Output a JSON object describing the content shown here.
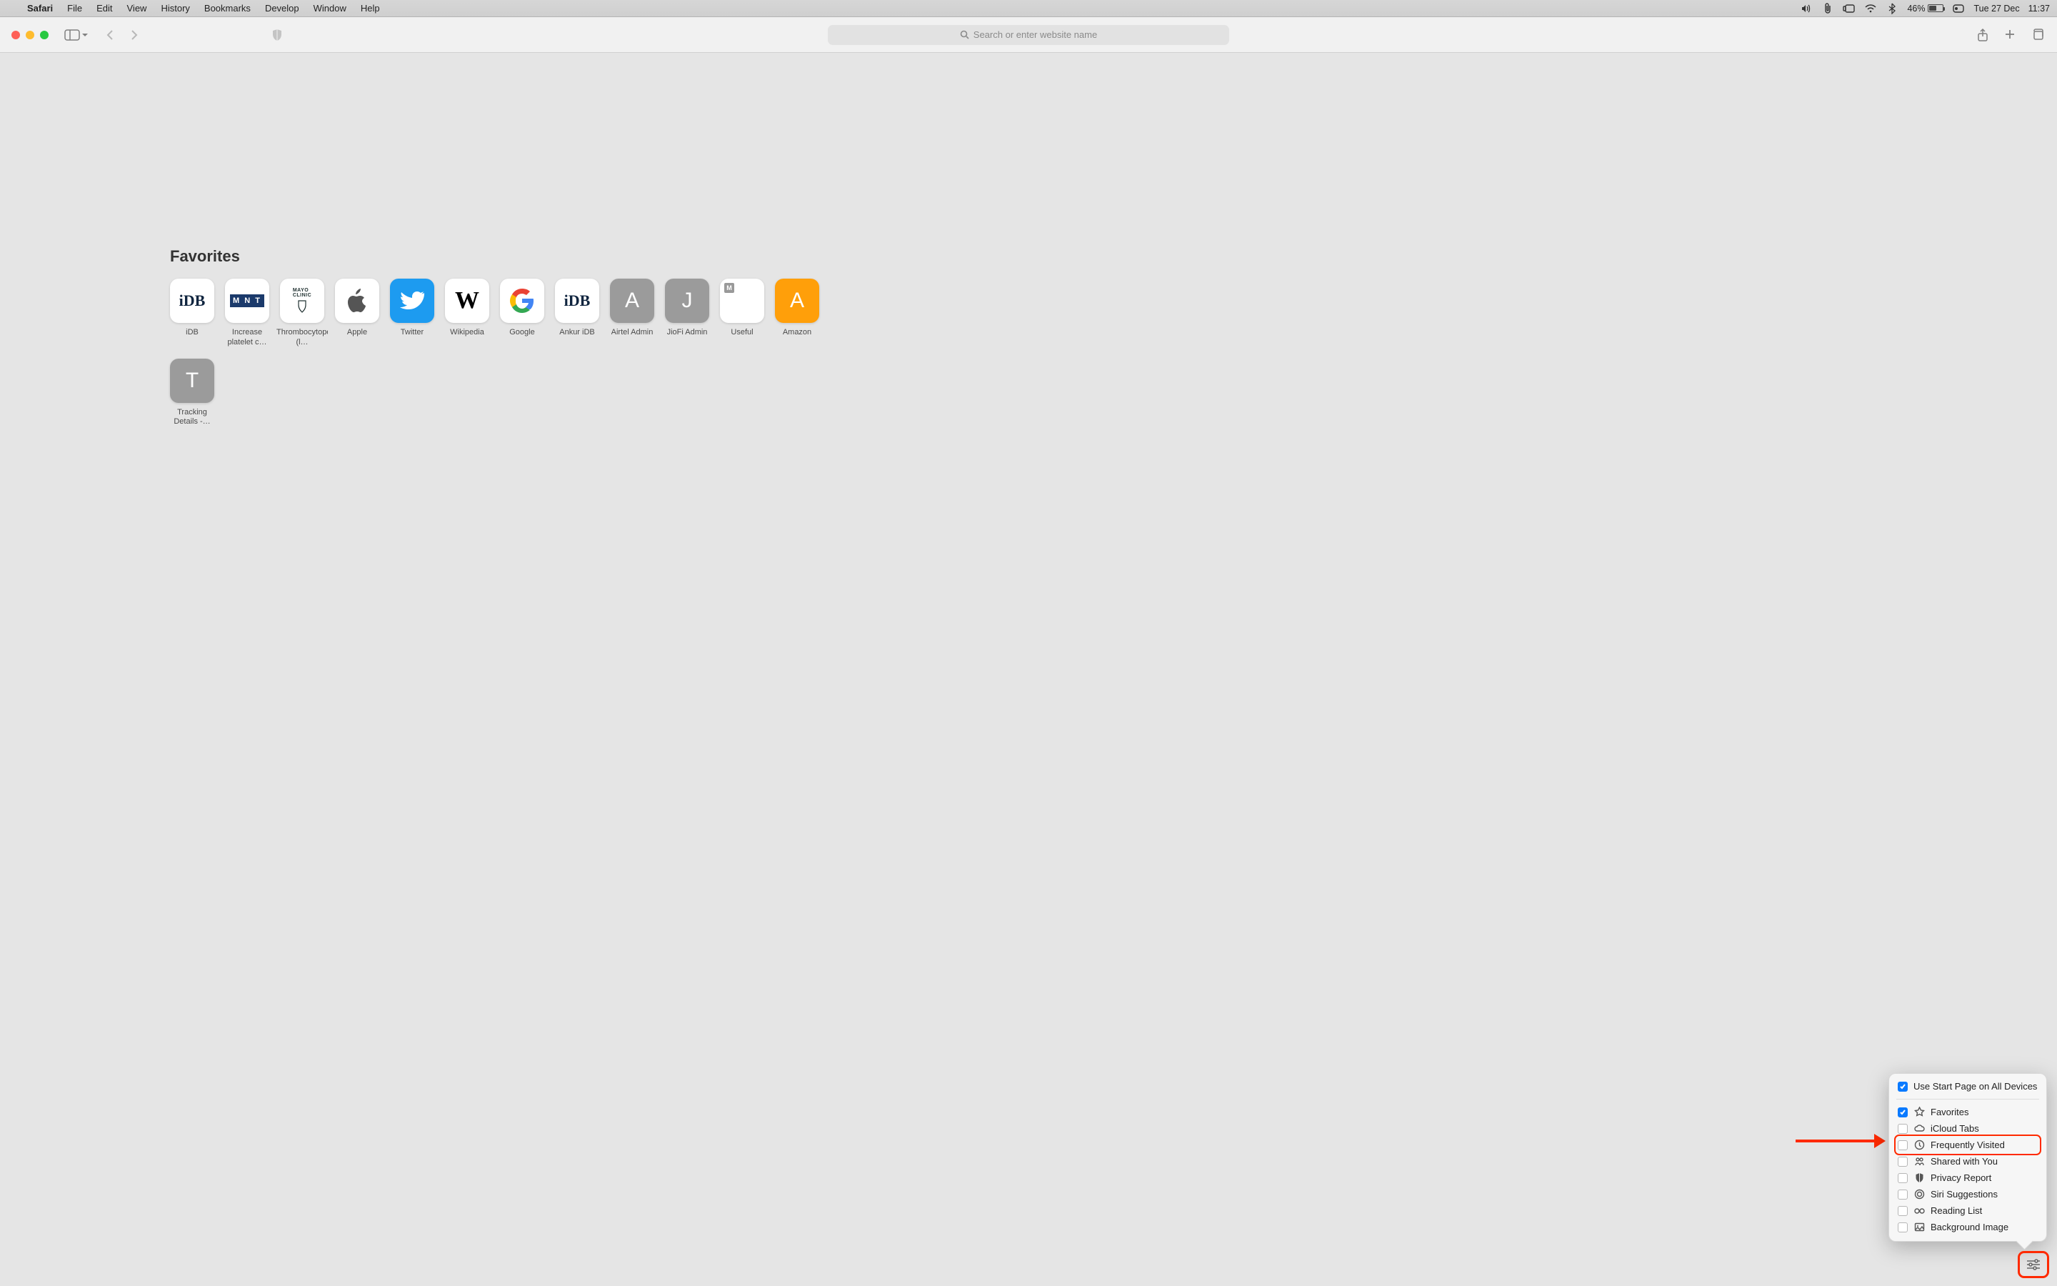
{
  "menubar": {
    "app": "Safari",
    "items": [
      "File",
      "Edit",
      "View",
      "History",
      "Bookmarks",
      "Develop",
      "Window",
      "Help"
    ],
    "battery_pct": "46%",
    "date": "Tue 27 Dec",
    "time": "11:37"
  },
  "toolbar": {
    "search_placeholder": "Search or enter website name"
  },
  "favorites": {
    "title": "Favorites",
    "items": [
      {
        "label": "iDB",
        "kind": "idb"
      },
      {
        "label": "Increase platelet c…",
        "kind": "mnt"
      },
      {
        "label": "Thrombocytopenia (l…",
        "kind": "mayo"
      },
      {
        "label": "Apple",
        "kind": "apple"
      },
      {
        "label": "Twitter",
        "kind": "twitter"
      },
      {
        "label": "Wikipedia",
        "kind": "wiki"
      },
      {
        "label": "Google",
        "kind": "google"
      },
      {
        "label": "Ankur iDB",
        "kind": "idb"
      },
      {
        "label": "Airtel Admin",
        "kind": "mono",
        "letter": "A",
        "bg": "#9b9b9b"
      },
      {
        "label": "JioFi Admin",
        "kind": "mono",
        "letter": "J",
        "bg": "#9b9b9b"
      },
      {
        "label": "Useful",
        "kind": "useful"
      },
      {
        "label": "Amazon",
        "kind": "mono",
        "letter": "A",
        "bg": "#ff9f0a"
      },
      {
        "label": "Tracking Details -…",
        "kind": "mono",
        "letter": "T",
        "bg": "#9b9b9b"
      }
    ]
  },
  "popover": {
    "header": "Use Start Page on All Devices",
    "header_checked": true,
    "rows": [
      {
        "label": "Favorites",
        "icon": "star",
        "checked": true,
        "highlight": false
      },
      {
        "label": "iCloud Tabs",
        "icon": "cloud",
        "checked": false,
        "highlight": false
      },
      {
        "label": "Frequently Visited",
        "icon": "clock",
        "checked": false,
        "highlight": true
      },
      {
        "label": "Shared with You",
        "icon": "people",
        "checked": false,
        "highlight": false
      },
      {
        "label": "Privacy Report",
        "icon": "shield",
        "checked": false,
        "highlight": false
      },
      {
        "label": "Siri Suggestions",
        "icon": "siri",
        "checked": false,
        "highlight": false
      },
      {
        "label": "Reading List",
        "icon": "glasses",
        "checked": false,
        "highlight": false
      },
      {
        "label": "Background Image",
        "icon": "image",
        "checked": false,
        "highlight": false
      }
    ]
  }
}
